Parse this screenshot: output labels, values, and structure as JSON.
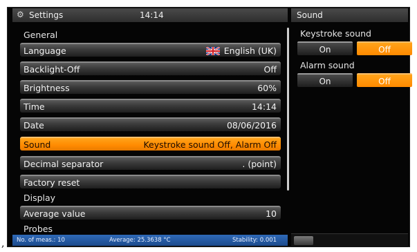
{
  "header": {
    "title": "Settings",
    "time": "14:14",
    "right_title": "Sound"
  },
  "sections": {
    "general": "General",
    "display": "Display",
    "probes": "Probes"
  },
  "rows": [
    {
      "label": "Language",
      "value": "English (UK)"
    },
    {
      "label": "Backlight-Off",
      "value": "Off"
    },
    {
      "label": "Brightness",
      "value": "60%"
    },
    {
      "label": "Time",
      "value": "14:14"
    },
    {
      "label": "Date",
      "value": "08/06/2016"
    },
    {
      "label": "Sound",
      "value": "Keystroke sound Off, Alarm Off"
    },
    {
      "label": "Decimal separator",
      "value": ". (point)"
    },
    {
      "label": "Factory reset",
      "value": ""
    },
    {
      "label": "Average value",
      "value": "10"
    }
  ],
  "sound": {
    "keystroke_label": "Keystroke sound",
    "alarm_label": "Alarm sound",
    "on_label": "On",
    "off_label": "Off"
  },
  "status": {
    "meas": "No. of meas.: 10",
    "average": "Average: 25.3638 °C",
    "stability": "Stability: 0.001"
  },
  "colors": {
    "accent": "#ff8a00",
    "statusbar": "#1c4a8c"
  },
  "prefix": ","
}
